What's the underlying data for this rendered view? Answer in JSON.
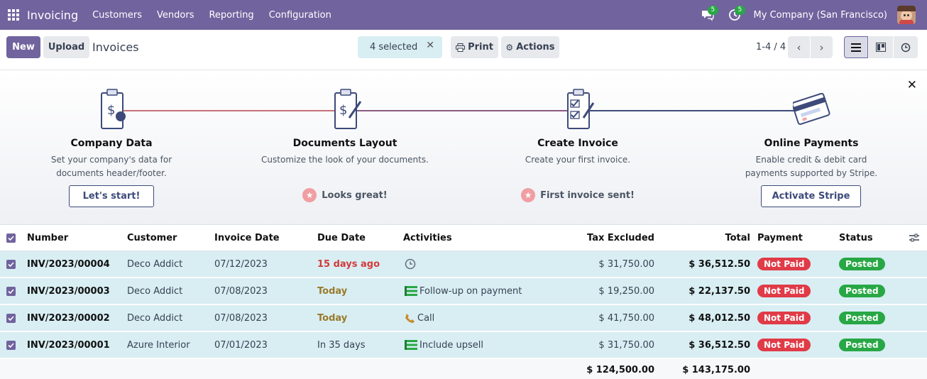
{
  "navbar": {
    "app_name": "Invoicing",
    "menu": [
      "Customers",
      "Vendors",
      "Reporting",
      "Configuration"
    ],
    "messages_count": "5",
    "activities_count": "5",
    "company": "My Company (San Francisco)"
  },
  "control": {
    "new_label": "New",
    "upload_label": "Upload",
    "title": "Invoices",
    "selected_label": "4 selected",
    "print_label": "Print",
    "actions_label": "Actions",
    "pager": "1-4 / 4"
  },
  "onboarding": {
    "steps": [
      {
        "title": "Company Data",
        "desc": "Set your company's data for documents header/footer.",
        "button": "Let's start!"
      },
      {
        "title": "Documents Layout",
        "desc": "Customize the look of your documents.",
        "done": "Looks great!"
      },
      {
        "title": "Create Invoice",
        "desc": "Create your first invoice.",
        "done": "First invoice sent!"
      },
      {
        "title": "Online Payments",
        "desc": "Enable credit & debit card payments supported by Stripe.",
        "button": "Activate Stripe"
      }
    ]
  },
  "table": {
    "headers": {
      "number": "Number",
      "customer": "Customer",
      "invoice_date": "Invoice Date",
      "due_date": "Due Date",
      "activities": "Activities",
      "tax_excluded": "Tax Excluded",
      "total": "Total",
      "payment": "Payment",
      "status": "Status"
    },
    "rows": [
      {
        "number": "INV/2023/00004",
        "customer": "Deco Addict",
        "invoice_date": "07/12/2023",
        "due_date": "15 days ago",
        "due_style": "overdue",
        "activity_icon": "clock-icon",
        "activity": "",
        "tax_excluded": "$ 31,750.00",
        "total": "$ 36,512.50",
        "payment": "Not Paid",
        "status": "Posted"
      },
      {
        "number": "INV/2023/00003",
        "customer": "Deco Addict",
        "invoice_date": "07/08/2023",
        "due_date": "Today",
        "due_style": "today",
        "activity_icon": "list-icon",
        "activity": "Follow-up on payment",
        "tax_excluded": "$ 19,250.00",
        "total": "$ 22,137.50",
        "payment": "Not Paid",
        "status": "Posted"
      },
      {
        "number": "INV/2023/00002",
        "customer": "Deco Addict",
        "invoice_date": "07/08/2023",
        "due_date": "Today",
        "due_style": "today",
        "activity_icon": "phone-icon",
        "activity": "Call",
        "tax_excluded": "$ 41,750.00",
        "total": "$ 48,012.50",
        "payment": "Not Paid",
        "status": "Posted"
      },
      {
        "number": "INV/2023/00001",
        "customer": "Azure Interior",
        "invoice_date": "07/01/2023",
        "due_date": "In 35 days",
        "due_style": "future",
        "activity_icon": "list-icon",
        "activity": "Include upsell",
        "tax_excluded": "$ 31,750.00",
        "total": "$ 36,512.50",
        "payment": "Not Paid",
        "status": "Posted"
      }
    ],
    "totals": {
      "tax_excluded": "$ 124,500.00",
      "total": "$ 143,175.00"
    }
  },
  "colors": {
    "brand": "#71639e",
    "selected_row": "#d8eef3",
    "overdue": "#d33b3b",
    "today": "#9a7a2a",
    "not_paid": "#e03b47",
    "posted": "#28a745"
  }
}
